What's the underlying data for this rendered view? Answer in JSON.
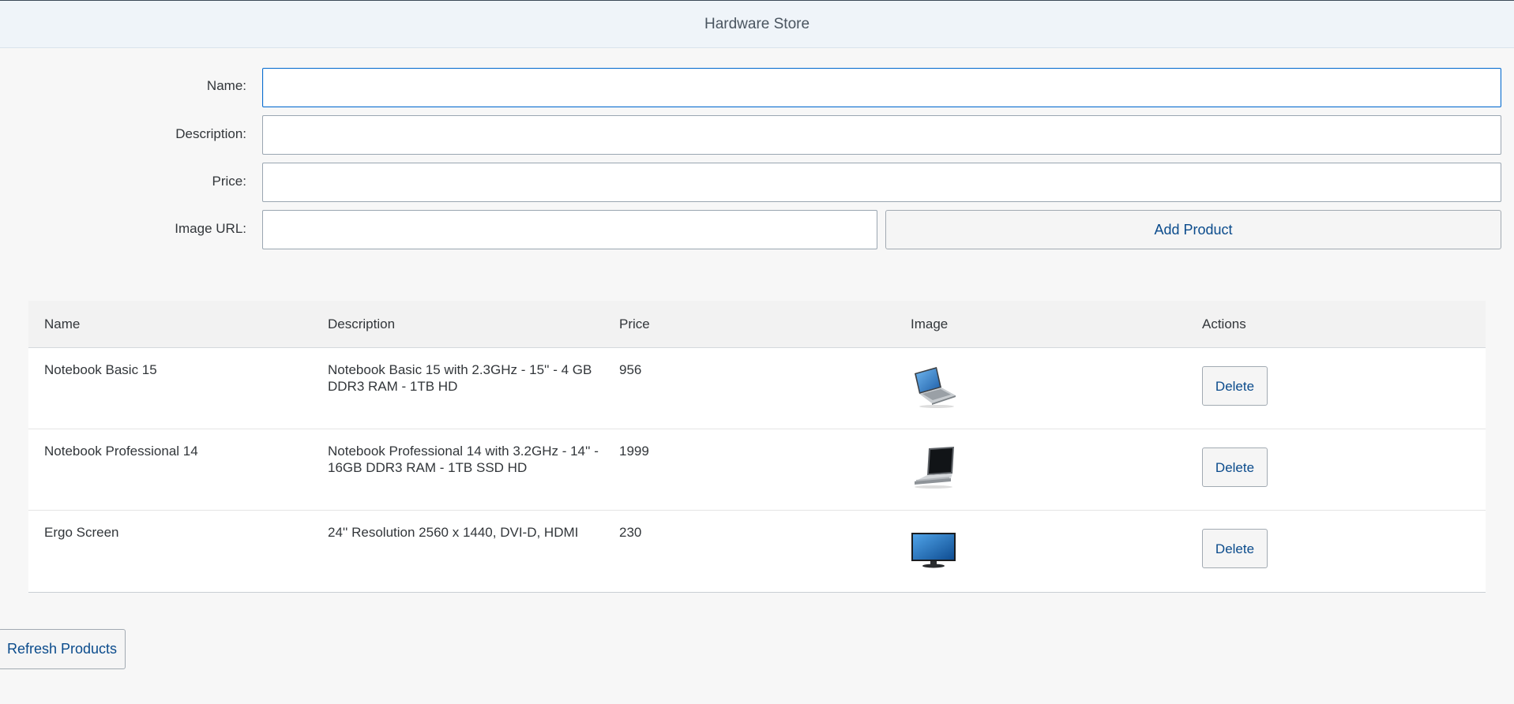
{
  "header": {
    "title": "Hardware Store"
  },
  "form": {
    "name_label": "Name:",
    "description_label": "Description:",
    "price_label": "Price:",
    "image_url_label": "Image URL:",
    "name_value": "",
    "description_value": "",
    "price_value": "",
    "image_url_value": "",
    "add_button_label": "Add Product"
  },
  "table": {
    "columns": [
      "Name",
      "Description",
      "Price",
      "Image",
      "Actions"
    ],
    "rows": [
      {
        "name": "Notebook Basic 15",
        "description": "Notebook Basic 15 with 2.3GHz - 15'' - 4 GB DDR3 RAM - 1TB HD",
        "price": "956",
        "image": "laptop-open-icon",
        "action": "Delete"
      },
      {
        "name": "Notebook Professional 14",
        "description": "Notebook Professional 14 with 3.2GHz - 14'' - 16GB DDR3 RAM - 1TB SSD HD",
        "price": "1999",
        "image": "laptop-silver-icon",
        "action": "Delete"
      },
      {
        "name": "Ergo Screen",
        "description": "24'' Resolution 2560 x 1440, DVI-D, HDMI",
        "price": "230",
        "image": "monitor-icon",
        "action": "Delete"
      }
    ]
  },
  "footer": {
    "refresh_button_label": "Refresh Products"
  },
  "colors": {
    "accent": "#0a6ed1",
    "header_bg": "#eff4f9",
    "page_bg": "#f7f7f7"
  }
}
